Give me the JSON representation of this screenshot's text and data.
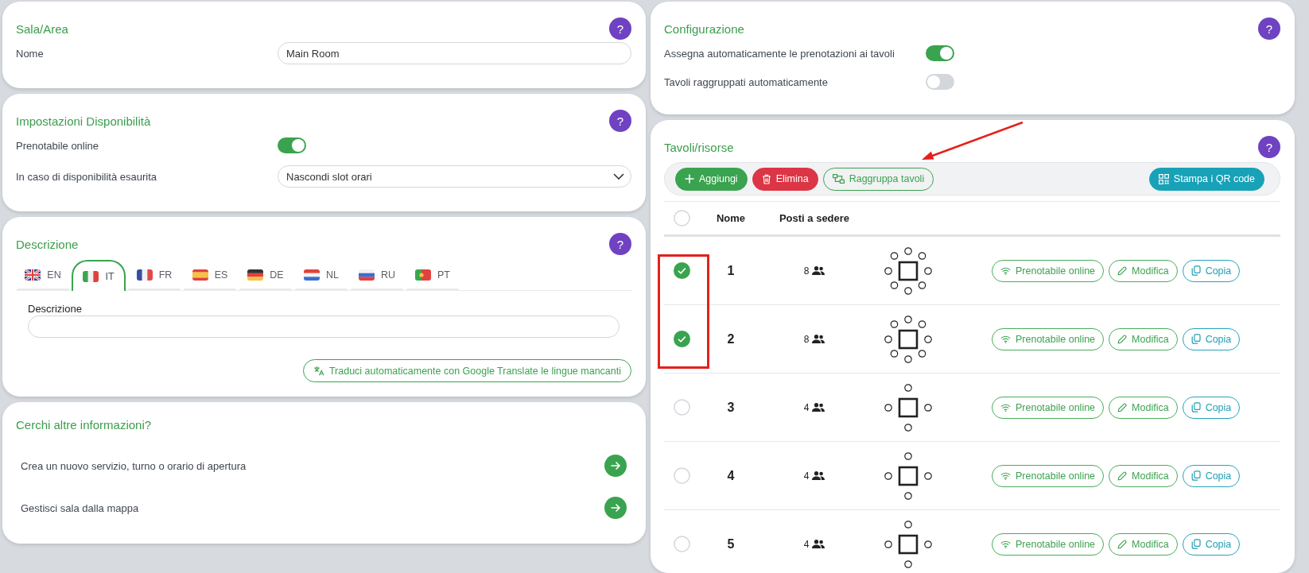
{
  "sala_area": {
    "title": "Sala/Area",
    "help": "?",
    "fields": [
      {
        "label": "Nome",
        "kind": "text",
        "value": "Main Room"
      }
    ]
  },
  "availability": {
    "title": "Impostazioni Disponibilità",
    "help": "?",
    "fields": [
      {
        "label": "Prenotabile online",
        "kind": "toggle",
        "on": true
      },
      {
        "label": "In caso di disponibilità esaurita",
        "kind": "select",
        "value": "Nascondi slot orari"
      }
    ]
  },
  "description": {
    "title": "Descrizione",
    "help": "?",
    "tabs": [
      {
        "label": "EN",
        "kind": "uk",
        "selected": false
      },
      {
        "label": "IT",
        "kind": "it",
        "selected": true
      },
      {
        "label": "FR",
        "kind": "fr",
        "selected": false
      },
      {
        "label": "ES",
        "kind": "es",
        "selected": false
      },
      {
        "label": "DE",
        "kind": "de",
        "selected": false
      },
      {
        "label": "NL",
        "kind": "nl",
        "selected": false
      },
      {
        "label": "RU",
        "kind": "ru",
        "selected": false
      },
      {
        "label": "PT",
        "kind": "pt",
        "selected": false
      }
    ],
    "field_label": "Descrizione",
    "translate_button": "Traduci automaticamente con Google Translate le lingue mancanti"
  },
  "more_info": {
    "title": "Cerchi altre informazioni?",
    "links": [
      {
        "label": "Crea un nuovo servizio, turno o orario di apertura"
      },
      {
        "label": "Gestisci sala dalla mappa"
      }
    ]
  },
  "configuration": {
    "title": "Configurazione",
    "help": "?",
    "fields": [
      {
        "label": "Assegna automaticamente le prenotazioni ai tavoli",
        "kind": "toggle",
        "on": true
      },
      {
        "label": "Tavoli raggruppati automaticamente",
        "kind": "toggle",
        "on": false
      }
    ]
  },
  "tables": {
    "title": "Tavoli/risorse",
    "help": "?",
    "toolbar": [
      {
        "label": "Aggiungi",
        "kind": "add"
      },
      {
        "label": "Elimina",
        "kind": "delete"
      },
      {
        "label": "Raggruppa tavoli",
        "kind": "group"
      },
      {
        "label": "Stampa i QR code",
        "kind": "qr"
      }
    ],
    "header_checkbox": {
      "checked": false
    },
    "columns": [
      "Nome",
      "Posti a sedere"
    ],
    "rows": [
      {
        "selected": true,
        "name": "1",
        "seats": "8",
        "kind": "eight",
        "actions": [
          {
            "label": "Prenotabile online",
            "kind": "online"
          },
          {
            "label": "Modifica",
            "kind": "edit"
          },
          {
            "label": "Copia",
            "kind": "copy"
          }
        ]
      },
      {
        "selected": true,
        "name": "2",
        "seats": "8",
        "kind": "eight",
        "actions": [
          {
            "label": "Prenotabile online",
            "kind": "online"
          },
          {
            "label": "Modifica",
            "kind": "edit"
          },
          {
            "label": "Copia",
            "kind": "copy"
          }
        ]
      },
      {
        "selected": false,
        "name": "3",
        "seats": "4",
        "kind": "four",
        "actions": [
          {
            "label": "Prenotabile online",
            "kind": "online"
          },
          {
            "label": "Modifica",
            "kind": "edit"
          },
          {
            "label": "Copia",
            "kind": "copy"
          }
        ]
      },
      {
        "selected": false,
        "name": "4",
        "seats": "4",
        "kind": "four",
        "actions": [
          {
            "label": "Prenotabile online",
            "kind": "online"
          },
          {
            "label": "Modifica",
            "kind": "edit"
          },
          {
            "label": "Copia",
            "kind": "copy"
          }
        ]
      },
      {
        "selected": false,
        "name": "5",
        "seats": "4",
        "kind": "four",
        "actions": [
          {
            "label": "Prenotabile online",
            "kind": "online"
          },
          {
            "label": "Modifica",
            "kind": "edit"
          },
          {
            "label": "Copia",
            "kind": "copy"
          }
        ]
      }
    ]
  },
  "annotations": {
    "arrow": true,
    "highlight_box": true
  }
}
